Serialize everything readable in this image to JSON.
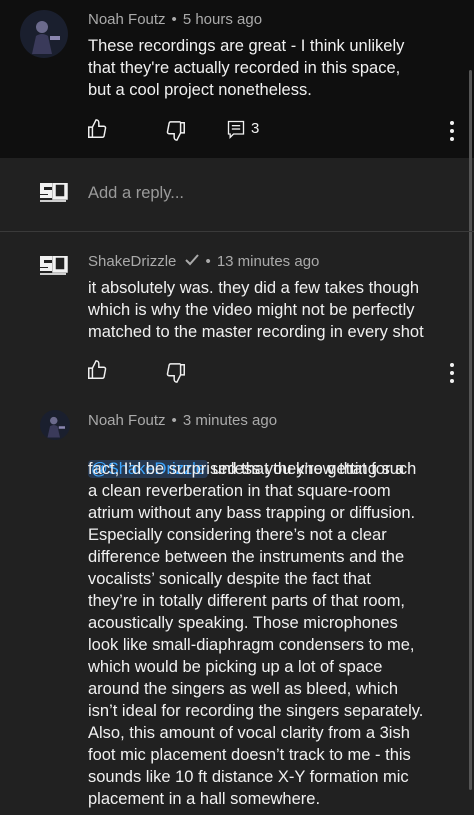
{
  "parent_comment": {
    "author": "Noah Foutz",
    "time": "5 hours ago",
    "text": "These recordings are great - I think unlikely\nthat they're actually recorded in this space,\nbut a cool project nonetheless.",
    "reply_count": "3",
    "icons": {
      "like": "thumbs-up-icon",
      "dislike": "thumbs-down-icon",
      "replies": "comment-icon",
      "menu": "more-vertical-icon"
    }
  },
  "reply_box": {
    "placeholder": "Add a reply..."
  },
  "replies": [
    {
      "author": "ShakeDrizzle",
      "verified": true,
      "time": "13 minutes ago",
      "text": "it absolutely was. they did a few takes though\nwhich is why the video might not be perfectly\nmatched to the master recording in every shot"
    },
    {
      "author": "Noah Foutz",
      "time": "3 minutes ago",
      "mention": "@ShakeDrizzle",
      "text_first": "unless you know that for a",
      "text": "fact, I’d be surprised that they’re getting such\na clean reverberation in that square-room\natrium without any bass trapping or diffusion.\nEspecially considering there’s not a clear\ndifference between the instruments and the\nvocalists’ sonically despite the fact that\nthey’re in totally different parts of that room,\nacoustically speaking. Those microphones\nlook like small-diaphragm condensers to me,\nwhich would be picking up a lot of space\naround the singers as well as bleed, which\nisn’t ideal for recording the singers separately.\nAlso, this amount of vocal clarity from a 3ish\nfoot mic placement doesn’t track to me - this\nsounds like 10 ft distance X-Y formation mic\nplacement in a hall somewhere."
    }
  ],
  "colors": {
    "background": "#212121",
    "parent_background": "#0f0f0f",
    "mention": "#3ea6ff"
  }
}
